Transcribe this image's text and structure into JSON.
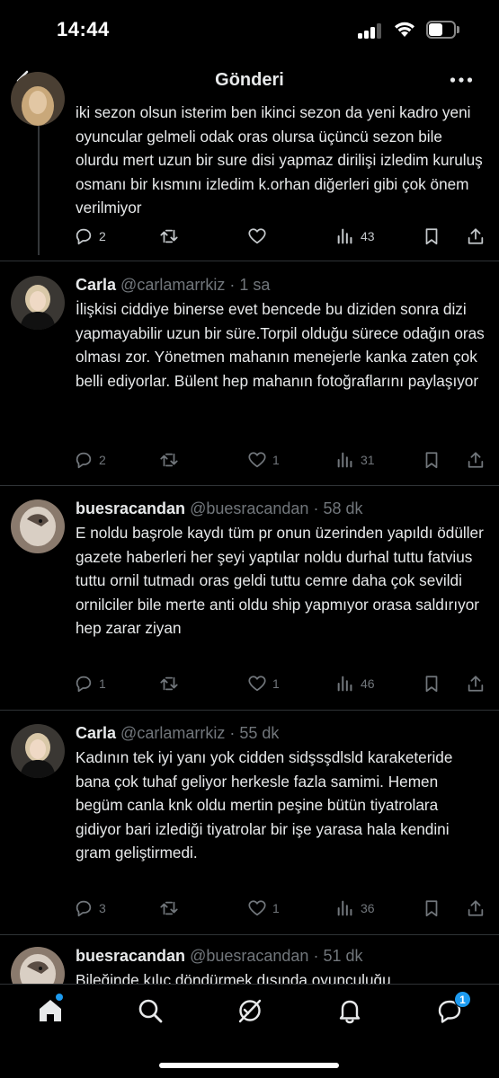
{
  "status_bar": {
    "time": "14:44"
  },
  "header": {
    "title": "Gönderi"
  },
  "tweets": [
    {
      "text": "iki sezon olsun isterim ben ikinci sezon da yeni kadro yeni oyuncular gelmeli odak oras olursa üçüncü sezon bile olurdu mert uzun bir sure disi yapmaz dirilişi izledim kuruluş osmanı bir kısmını izledim k.orhan diğerleri gibi çok önem verilmiyor",
      "replies": "2",
      "views": "43"
    },
    {
      "name": "Carla",
      "handle": "@carlamarrkiz",
      "time": "· 1 sa",
      "text": "İlişkisi ciddiye binerse evet bencede bu diziden sonra dizi yapmayabilir uzun bir süre.Torpil olduğu sürece odağın oras olması zor. Yönetmen mahanın menejerle kanka zaten çok belli ediyorlar. Bülent hep mahanın fotoğraflarını paylaşıyor",
      "replies": "2",
      "likes": "1",
      "views": "31"
    },
    {
      "name": "buesracandan",
      "handle": "@buesracandan",
      "time": "· 58 dk",
      "text": "E noldu başrole kaydı tüm pr onun üzerinden yapıldı ödüller gazete haberleri her şeyi yaptılar noldu durhal tuttu fatvius tuttu ornil tutmadı oras geldi tuttu cemre daha çok sevildi ornilciler bile merte anti oldu ship yapmıyor orasa saldırıyor hep zarar ziyan",
      "replies": "1",
      "likes": "1",
      "views": "46"
    },
    {
      "name": "Carla",
      "handle": "@carlamarrkiz",
      "time": "· 55 dk",
      "text": "Kadının tek iyi yanı yok cidden sidşsşdlsld karaketeride bana çok tuhaf geliyor herkesle fazla samimi. Hemen begüm canla knk oldu mertin peşine bütün tiyatrolara gidiyor bari izlediği tiyatrolar bir işe yarasa hala kendini gram geliştirmedi.",
      "replies": "3",
      "likes": "1",
      "views": "36"
    },
    {
      "name": "buesracandan",
      "handle": "@buesracandan",
      "time": "· 51 dk",
      "text": "Bileğinde kılıç döndürmek dışında oyunculuğu"
    }
  ],
  "bottom_nav": {
    "messages_badge": "1"
  },
  "colors": {
    "background": "#000000",
    "text": "#e7e9ea",
    "muted": "#71767b",
    "accent": "#1d9bf0"
  }
}
